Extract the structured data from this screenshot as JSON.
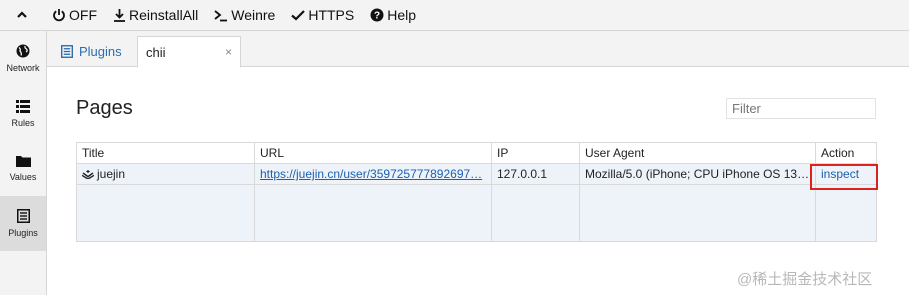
{
  "toolbar": {
    "buttons": [
      {
        "label": "OFF",
        "icon": "power-icon"
      },
      {
        "label": "ReinstallAll",
        "icon": "download-icon"
      },
      {
        "label": "Weinre",
        "icon": "terminal-icon"
      },
      {
        "label": "HTTPS",
        "icon": "check-icon"
      },
      {
        "label": "Help",
        "icon": "help-icon"
      }
    ]
  },
  "sidebar": {
    "items": [
      {
        "label": "Network",
        "icon": "globe-icon"
      },
      {
        "label": "Rules",
        "icon": "list-icon"
      },
      {
        "label": "Values",
        "icon": "folder-icon"
      },
      {
        "label": "Plugins",
        "icon": "plugin-list-icon",
        "active": true
      }
    ]
  },
  "tabs": [
    {
      "label": "Plugins",
      "icon": "plugin-list-icon"
    },
    {
      "label": "chii",
      "close": "×",
      "active": true
    }
  ],
  "main": {
    "title": "Pages",
    "filter_placeholder": "Filter",
    "table": {
      "columns": [
        "Title",
        "URL",
        "IP",
        "User Agent",
        "Action"
      ],
      "rows": [
        {
          "title": "juejin",
          "url": "https://juejin.cn/user/359725777892697…",
          "ip": "127.0.0.1",
          "user_agent": "Mozilla/5.0 (iPhone; CPU iPhone OS 13…",
          "action": "inspect"
        }
      ]
    }
  },
  "watermark": "@稀土掘金技术社区",
  "colors": {
    "link": "#1b5fb0",
    "highlight": "#d9231f",
    "row_bg": "#eef3fa"
  }
}
